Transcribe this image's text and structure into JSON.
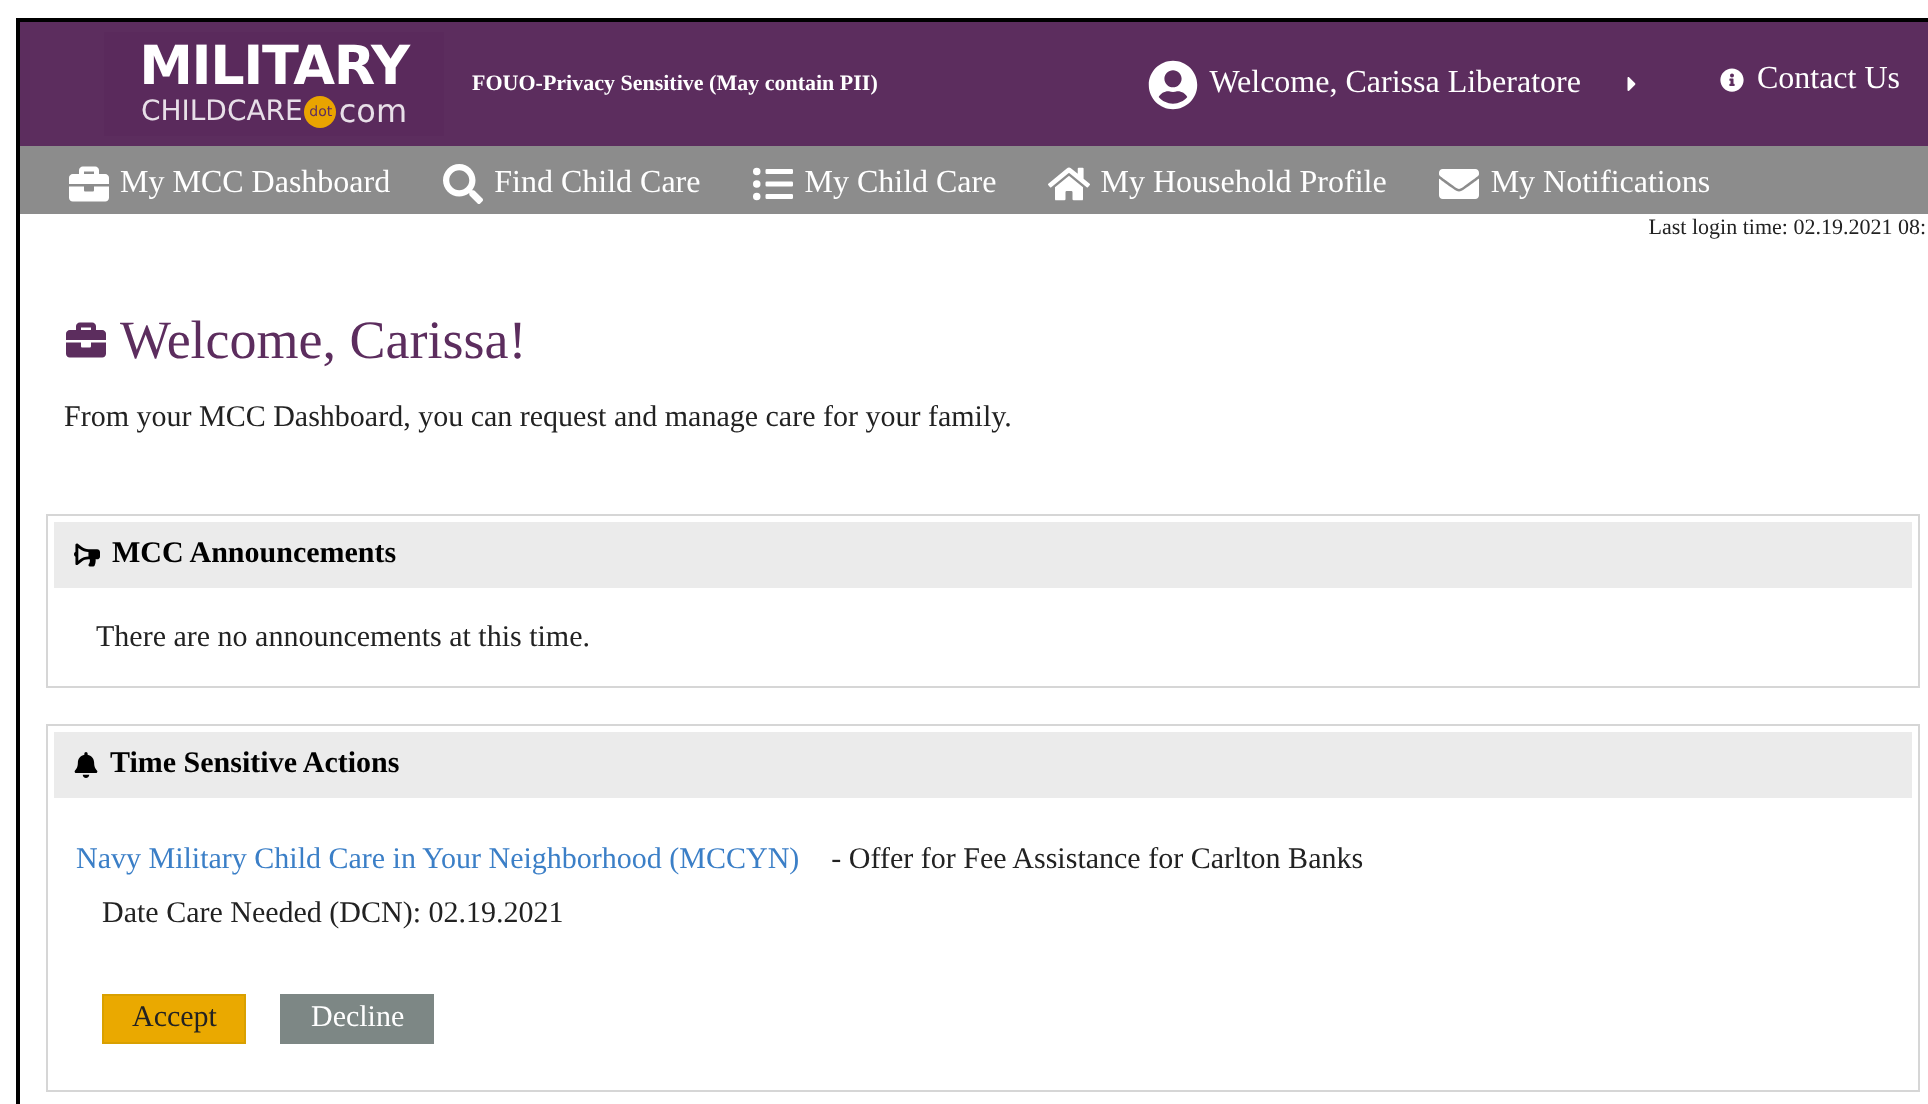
{
  "header": {
    "logo": {
      "line_1": "MILITARY",
      "line_2": "CHILDCARE",
      "badge": "dot",
      "suffix": "com"
    },
    "notice": "FOUO-Privacy Sensitive (May contain PII)",
    "user_menu": "Welcome, Carissa Liberatore",
    "contact": "Contact Us"
  },
  "nav": [
    {
      "label": "My MCC Dashboard"
    },
    {
      "label": "Find Child Care"
    },
    {
      "label": "My Child Care"
    },
    {
      "label": "My Household Profile"
    },
    {
      "label": "My Notifications"
    }
  ],
  "last_login": "Last login time: 02.19.2021 08:",
  "page": {
    "title": "Welcome, Carissa!",
    "intro": "From your MCC Dashboard, you can request and manage care for your family."
  },
  "announcements": {
    "title": "MCC Announcements",
    "message": "There are no announcements at this time."
  },
  "actions": {
    "title": "Time Sensitive Actions",
    "items": [
      {
        "program": "Navy Military Child Care in Your Neighborhood (MCCYN)",
        "description": "- Offer for Fee Assistance for Carlton Banks",
        "date": "Date Care Needed (DCN): 02.19.2021",
        "buttons": [
          {
            "label": "Accept",
            "kind": "primary"
          },
          {
            "label": "Decline",
            "kind": "secondary"
          }
        ]
      }
    ]
  }
}
